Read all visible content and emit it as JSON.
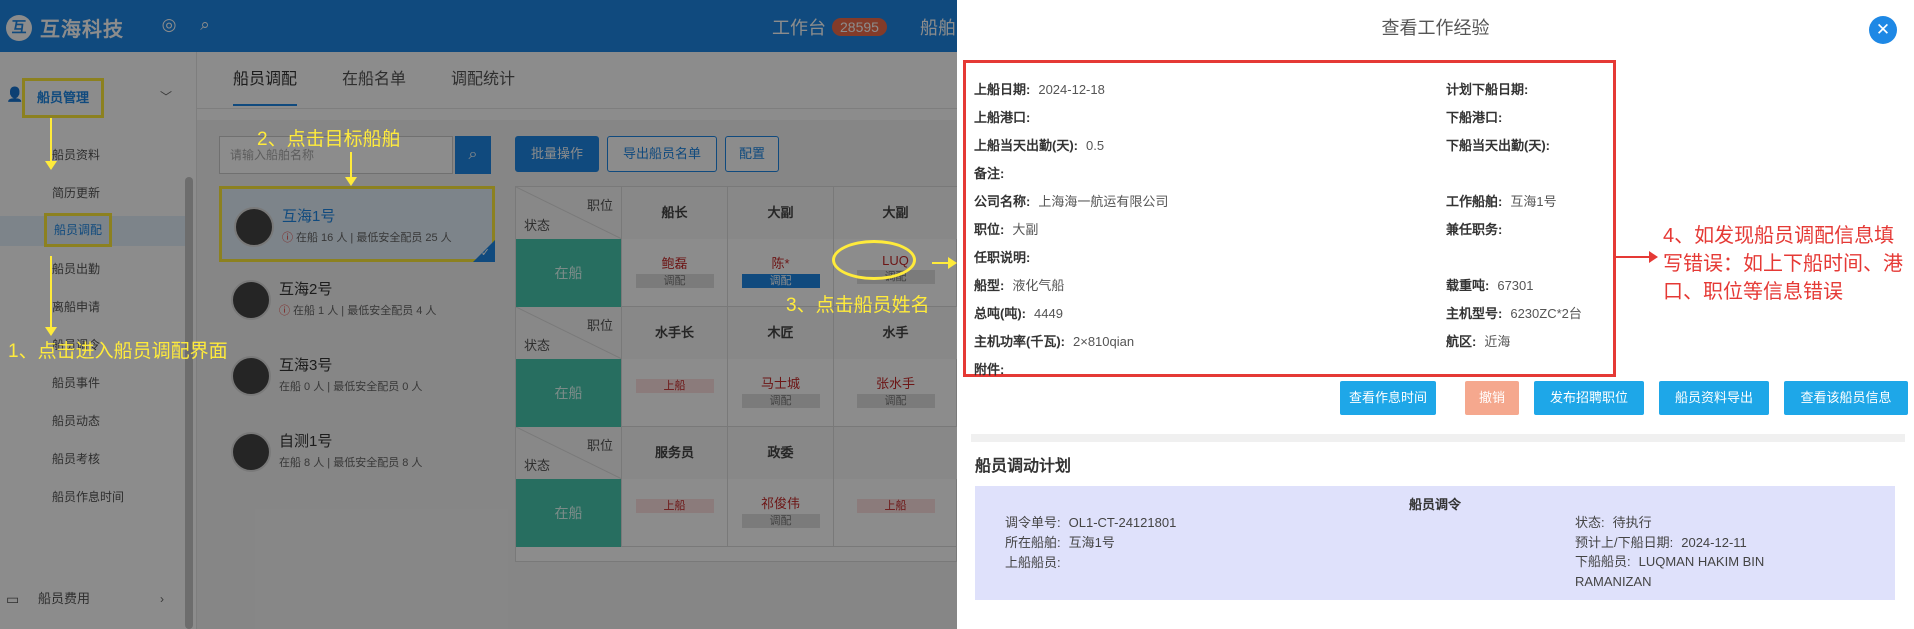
{
  "topbar": {
    "logo_mark": "互",
    "logo_text": "互海科技",
    "back_icon": "◎",
    "search_icon": "⌕",
    "workbench_label": "工作台",
    "workbench_count": "28595",
    "ship_menu": "船舶"
  },
  "sidebar": {
    "group_label": "船员管理",
    "items": [
      "船员资料",
      "简历更新",
      "船员调配",
      "船员出勤",
      "离船申请",
      "船员调令",
      "船员事件",
      "船员动态",
      "船员考核",
      "船员作息时间"
    ],
    "fee_label": "船员费用"
  },
  "main": {
    "tabs": [
      "船员调配",
      "在船名单",
      "调配统计"
    ],
    "search_placeholder": "请输入船舶名称",
    "toolbar": {
      "batch": "批量操作",
      "export": "导出船员名单",
      "config": "配置"
    },
    "ships": [
      {
        "name": "互海1号",
        "meta": "在船 16 人 | 最低安全配员 25 人",
        "warn": true
      },
      {
        "name": "互海2号",
        "meta": "在船 1 人 | 最低安全配员 4 人",
        "warn": true
      },
      {
        "name": "互海3号",
        "meta": "在船 0 人 | 最低安全配员 0 人",
        "warn": false
      },
      {
        "name": "自测1号",
        "meta": "在船 8 人 | 最低安全配员 8 人",
        "warn": false
      }
    ],
    "grid": {
      "corner_top": "职位",
      "corner_bottom": "状态",
      "status_label": "在船",
      "row1_roles": [
        "船长",
        "大副",
        "大副"
      ],
      "row1_cells": [
        {
          "name": "鲍磊",
          "tag": "调配"
        },
        {
          "name": "陈*",
          "tag": "调配"
        },
        {
          "name": "LUQ",
          "tag": "调配"
        }
      ],
      "row2_roles": [
        "水手长",
        "木匠",
        "水手"
      ],
      "row2_cells": [
        {
          "name": "",
          "tag": "上船"
        },
        {
          "name": "马士城",
          "tag": "调配"
        },
        {
          "name": "张水手",
          "tag": "调配"
        }
      ],
      "row3_roles": [
        "服务员",
        "政委",
        ""
      ],
      "row3_cells": [
        {
          "name": "",
          "tag": "上船"
        },
        {
          "name": "祁俊伟",
          "tag": "调配"
        },
        {
          "name": "",
          "tag": "上船"
        }
      ]
    }
  },
  "annotations": {
    "step1": "1、点击进入船员调配界面",
    "step2": "2、点击目标船舶",
    "step3": "3、点击船员姓名",
    "step4": "4、如发现船员调配信息填写错误：如上下船时间、港口、职位等信息错误"
  },
  "drawer": {
    "title": "查看工作经验",
    "close_icon": "✕",
    "left_fields": [
      {
        "k": "上船日期:",
        "v": "2024-12-18"
      },
      {
        "k": "上船港口:",
        "v": ""
      },
      {
        "k": "上船当天出勤(天):",
        "v": "0.5"
      },
      {
        "k": "备注:",
        "v": ""
      },
      {
        "k": "公司名称:",
        "v": "上海海一航运有限公司"
      },
      {
        "k": "职位:",
        "v": "大副"
      },
      {
        "k": "任职说明:",
        "v": ""
      },
      {
        "k": "船型:",
        "v": "液化气船"
      },
      {
        "k": "总吨(吨):",
        "v": "4449"
      },
      {
        "k": "主机功率(千瓦):",
        "v": "2×810qian"
      },
      {
        "k": "附件:",
        "v": ""
      }
    ],
    "right_fields": [
      {
        "k": "计划下船日期:",
        "v": ""
      },
      {
        "k": "下船港口:",
        "v": ""
      },
      {
        "k": "下船当天出勤(天):",
        "v": ""
      },
      {
        "k": "",
        "v": ""
      },
      {
        "k": "工作船舶:",
        "v": "互海1号"
      },
      {
        "k": "兼任职务:",
        "v": ""
      },
      {
        "k": "",
        "v": ""
      },
      {
        "k": "载重吨:",
        "v": "67301"
      },
      {
        "k": "主机型号:",
        "v": "6230ZC*2台"
      },
      {
        "k": "航区:",
        "v": "近海"
      },
      {
        "k": "",
        "v": ""
      }
    ],
    "buttons": [
      "查看作息时间",
      "撤销",
      "发布招聘职位",
      "船员资料导出",
      "查看该船员信息"
    ],
    "plan": {
      "title": "船员调动计划",
      "heading": "船员调令",
      "order_no_label": "调令单号:",
      "order_no": "OL1-CT-24121801",
      "ship_label": "所在船舶:",
      "ship": "互海1号",
      "onboard_label": "上船船员:",
      "onboard": "",
      "status_label": "状态:",
      "status": "待执行",
      "date_label": "预计上/下船日期:",
      "date": "2024-12-11",
      "offboard_label": "下船船员:",
      "offboard": "LUQMAN HAKIM BIN RAMANIZAN"
    }
  },
  "colors": {
    "primary": "#1e88e5",
    "annotation": "#ffeb3b",
    "alert": "#e53935",
    "status_teal": "#48c9b0"
  }
}
